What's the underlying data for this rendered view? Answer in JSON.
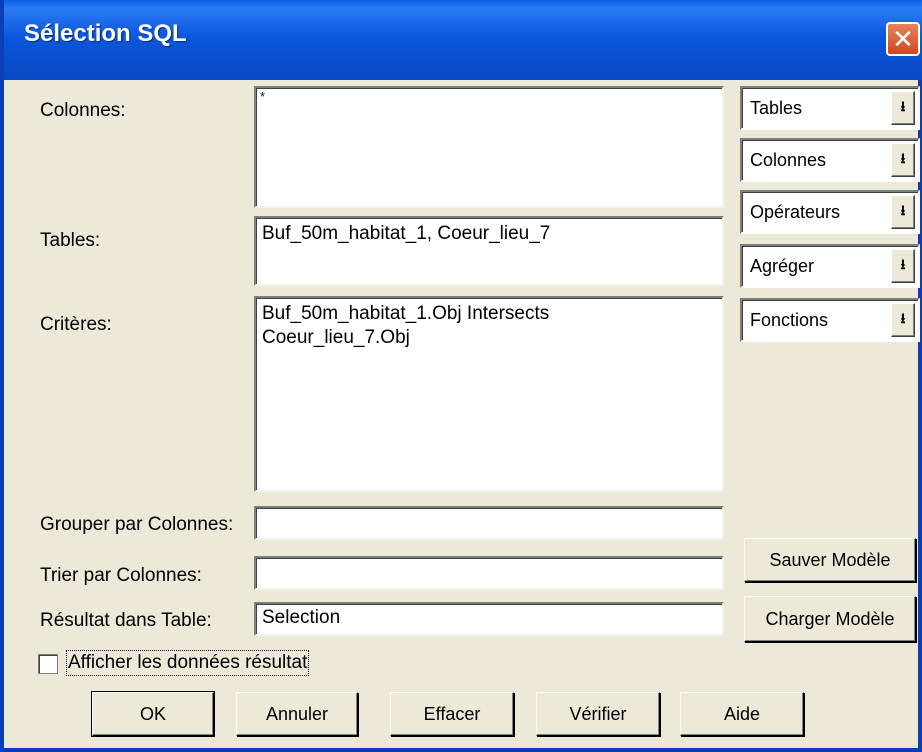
{
  "window": {
    "title": "Sélection SQL"
  },
  "labels": {
    "colonnes": "Colonnes:",
    "tables": "Tables:",
    "criteres": "Critères:",
    "grouper": "Grouper par Colonnes:",
    "trier": "Trier par Colonnes:",
    "resultat": "Résultat dans Table:"
  },
  "fields": {
    "colonnes": "*",
    "tables": "Buf_50m_habitat_1, Coeur_lieu_7",
    "criteres": "Buf_50m_habitat_1.Obj Intersects\nCoeur_lieu_7.Obj",
    "grouper": "",
    "trier": "",
    "resultat": "Selection"
  },
  "combos": [
    {
      "label": "Tables"
    },
    {
      "label": "Colonnes"
    },
    {
      "label": "Opérateurs"
    },
    {
      "label": "Agréger"
    },
    {
      "label": "Fonctions"
    }
  ],
  "buttons": {
    "sauver": "Sauver Modèle",
    "charger": "Charger Modèle",
    "ok": "OK",
    "annuler": "Annuler",
    "effacer": "Effacer",
    "verifier": "Vérifier",
    "aide": "Aide"
  },
  "checkbox": {
    "label": "Afficher les données résultat",
    "checked": false
  }
}
